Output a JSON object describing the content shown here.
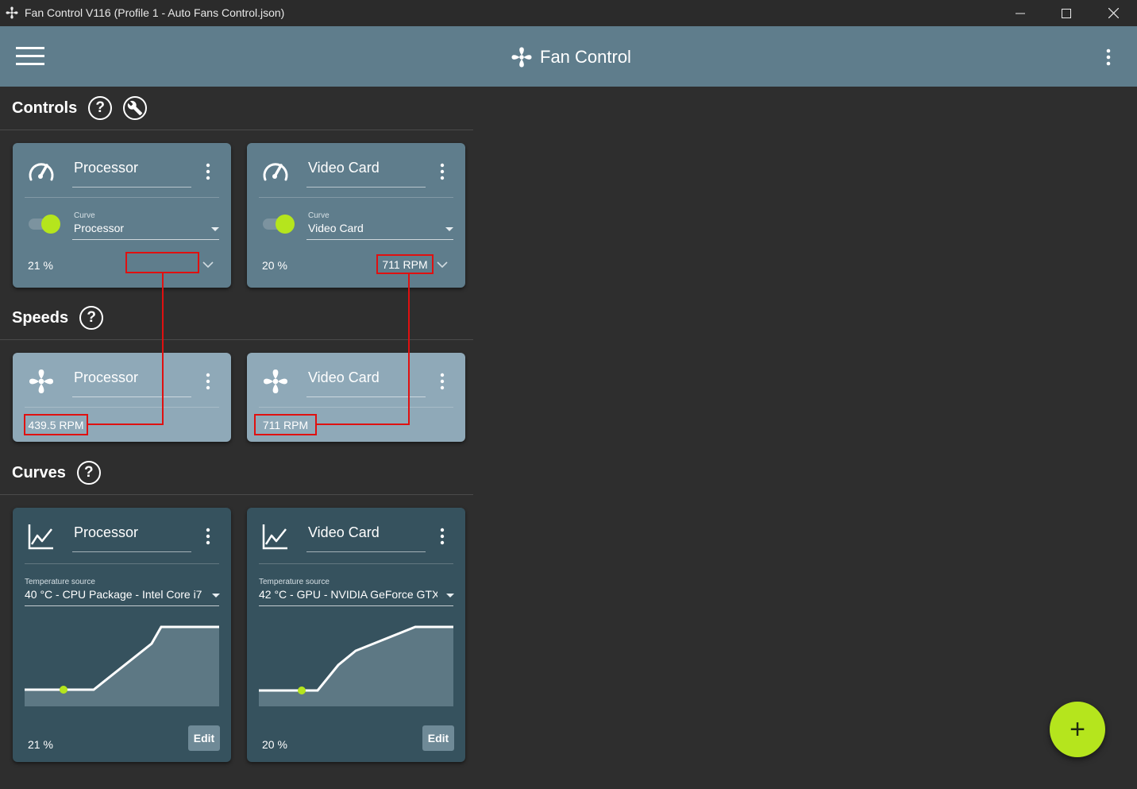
{
  "window": {
    "title": "Fan Control V116 (Profile 1 - Auto Fans Control.json)"
  },
  "appbar": {
    "brand": "Fan Control"
  },
  "sections": {
    "controls": "Controls",
    "speeds": "Speeds",
    "curves": "Curves",
    "help_glyph": "?"
  },
  "controls": [
    {
      "name": "Processor",
      "curve_label": "Curve",
      "curve_value": "Processor",
      "percent": "21 %",
      "rpm": "",
      "enabled": true
    },
    {
      "name": "Video Card",
      "curve_label": "Curve",
      "curve_value": "Video Card",
      "percent": "20 %",
      "rpm": "711 RPM",
      "enabled": true
    }
  ],
  "speeds": [
    {
      "name": "Processor",
      "rpm": "439.5 RPM"
    },
    {
      "name": "Video Card",
      "rpm": "711 RPM"
    }
  ],
  "curves": [
    {
      "name": "Processor",
      "source_label": "Temperature source",
      "source_value": "40 °C - CPU Package - Intel Core i7",
      "percent": "21 %",
      "edit": "Edit"
    },
    {
      "name": "Video Card",
      "source_label": "Temperature source",
      "source_value": "42 °C - GPU - NVIDIA GeForce GTX",
      "percent": "20 %",
      "edit": "Edit"
    }
  ],
  "fab": {
    "glyph": "+"
  },
  "colors": {
    "accent": "#b5e51d",
    "appbar": "#5f7d8c",
    "background": "#2e2e2e",
    "highlight_box": "#e01010"
  }
}
